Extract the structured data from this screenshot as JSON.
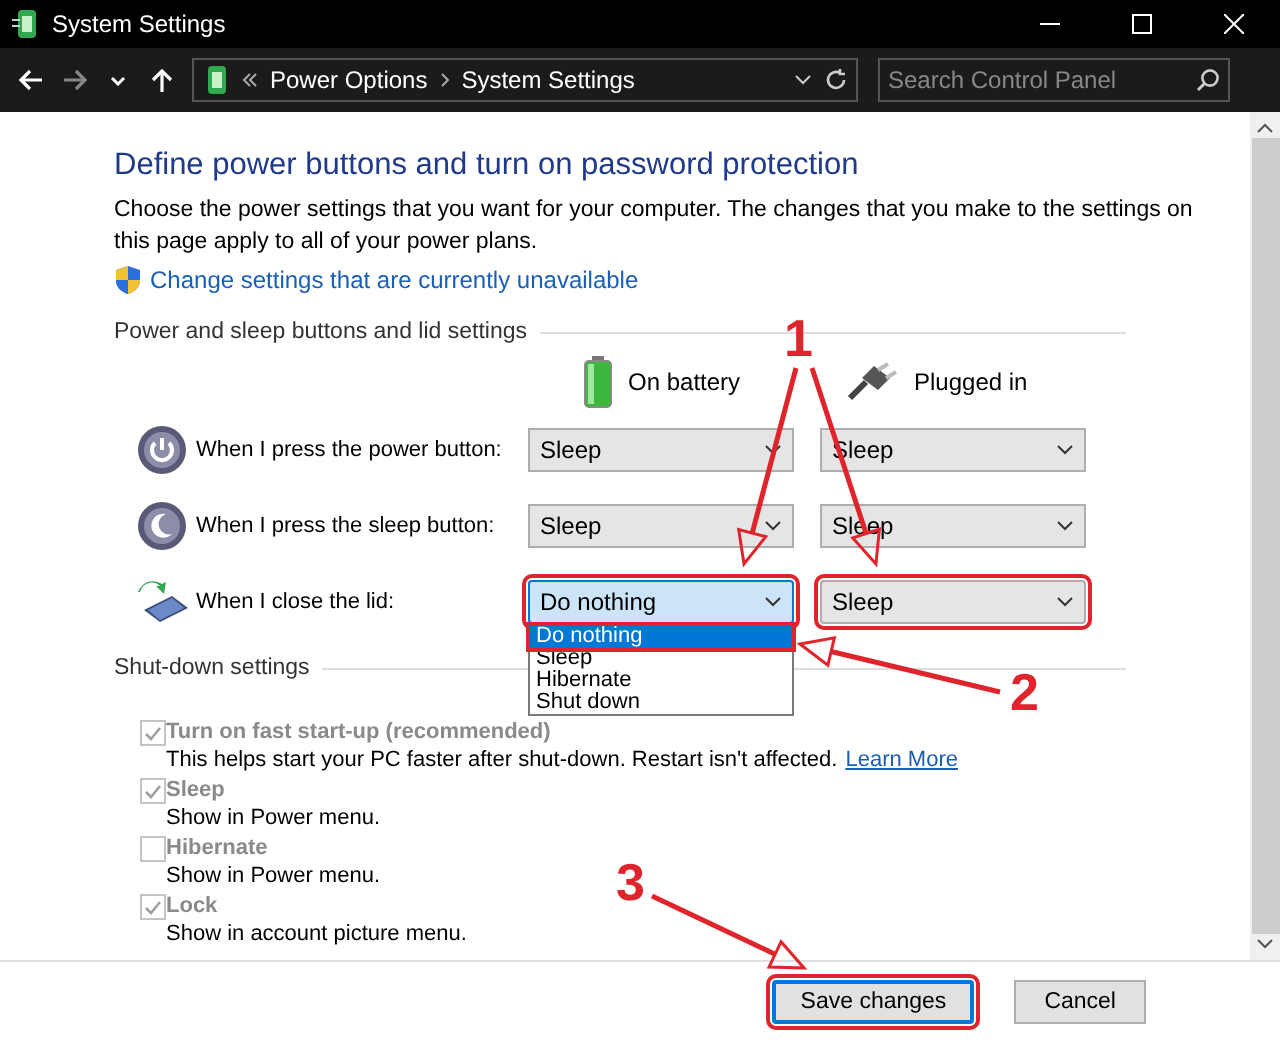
{
  "window": {
    "title": "System Settings"
  },
  "address_bar": {
    "path": [
      "Power Options",
      "System Settings"
    ],
    "search_placeholder": "Search Control Panel"
  },
  "page": {
    "heading": "Define power buttons and turn on password protection",
    "description": "Choose the power settings that you want for your computer. The changes that you make to the settings on this page apply to all of your power plans.",
    "link": "Change settings that are currently unavailable"
  },
  "power_section": {
    "title": "Power and sleep buttons and lid settings",
    "columns": [
      "On battery",
      "Plugged in"
    ],
    "rows": [
      {
        "kind": "power",
        "label": "When I press the power button:",
        "settings": [
          {
            "value": "Sleep",
            "open": false,
            "highlighted": false
          },
          {
            "value": "Sleep",
            "open": false,
            "highlighted": false
          }
        ]
      },
      {
        "kind": "sleep",
        "label": "When I press the sleep button:",
        "settings": [
          {
            "value": "Sleep",
            "open": false,
            "highlighted": false
          },
          {
            "value": "Sleep",
            "open": false,
            "highlighted": false
          }
        ]
      },
      {
        "kind": "lid",
        "label": "When I close the lid:",
        "settings": [
          {
            "value": "Do nothing",
            "open": true,
            "highlighted": true,
            "options": [
              {
                "label": "Do nothing",
                "selected": true,
                "highlighted": true
              },
              {
                "label": "Sleep",
                "selected": false,
                "highlighted": false
              },
              {
                "label": "Hibernate",
                "selected": false,
                "highlighted": false
              },
              {
                "label": "Shut down",
                "selected": false,
                "highlighted": false
              }
            ]
          },
          {
            "value": "Sleep",
            "open": false,
            "highlighted": true
          }
        ]
      }
    ]
  },
  "shutdown_section": {
    "title": "Shut-down settings",
    "items": [
      {
        "label": "Turn on fast start-up (recommended)",
        "checked": true,
        "disabled": true,
        "description": "This helps start your PC faster after shut-down. Restart isn't affected.",
        "link": "Learn More"
      },
      {
        "label": "Sleep",
        "checked": true,
        "disabled": true,
        "description": "Show in Power menu."
      },
      {
        "label": "Hibernate",
        "checked": false,
        "disabled": true,
        "description": "Show in Power menu."
      },
      {
        "label": "Lock",
        "checked": true,
        "disabled": true,
        "description": "Show in account picture menu."
      }
    ]
  },
  "buttons": [
    {
      "label": "Save changes",
      "default": true,
      "highlighted": true
    },
    {
      "label": "Cancel",
      "default": false,
      "highlighted": false
    }
  ],
  "annotations": [
    {
      "label": "1"
    },
    {
      "label": "2"
    },
    {
      "label": "3"
    }
  ]
}
